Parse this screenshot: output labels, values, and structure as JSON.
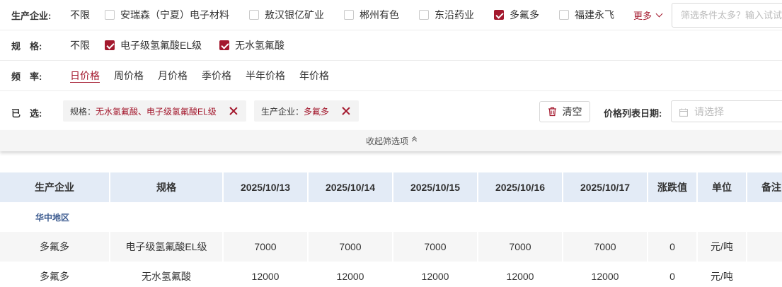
{
  "filters": {
    "producer": {
      "label": "生产企业:",
      "unlimited": "不限",
      "options": [
        {
          "label": "安瑞森（宁夏）电子材料",
          "checked": false
        },
        {
          "label": "敖汉银亿矿业",
          "checked": false
        },
        {
          "label": "郴州有色",
          "checked": false
        },
        {
          "label": "东沿药业",
          "checked": false
        },
        {
          "label": "多氟多",
          "checked": true
        },
        {
          "label": "福建永飞",
          "checked": false
        }
      ],
      "more_label": "更多",
      "search_placeholder": "筛选条件太多？输入试试"
    },
    "spec": {
      "label": "规　格:",
      "unlimited": "不限",
      "options": [
        {
          "label": "电子级氢氟酸EL级",
          "checked": true
        },
        {
          "label": "无水氢氟酸",
          "checked": true
        }
      ]
    },
    "frequency": {
      "label": "频　率:",
      "options": [
        {
          "label": "日价格",
          "active": true
        },
        {
          "label": "周价格",
          "active": false
        },
        {
          "label": "月价格",
          "active": false
        },
        {
          "label": "季价格",
          "active": false
        },
        {
          "label": "半年价格",
          "active": false
        },
        {
          "label": "年价格",
          "active": false
        }
      ]
    },
    "selected": {
      "label": "已　选:",
      "tags": [
        {
          "key": "规格：",
          "value": "无水氢氟酸、电子级氢氟酸EL级"
        },
        {
          "key": "生产企业：",
          "value": "多氟多"
        }
      ],
      "clear_label": "清空",
      "date_label": "价格列表日期:",
      "date_placeholder": "请选择"
    },
    "collapse_label": "收起筛选项"
  },
  "table": {
    "headers": [
      "生产企业",
      "规格",
      "2025/10/13",
      "2025/10/14",
      "2025/10/15",
      "2025/10/16",
      "2025/10/17",
      "涨跌值",
      "单位",
      "备注"
    ],
    "region": "华中地区",
    "rows": [
      [
        "多氟多",
        "电子级氢氟酸EL级",
        "7000",
        "7000",
        "7000",
        "7000",
        "7000",
        "0",
        "元/吨",
        ""
      ],
      [
        "多氟多",
        "无水氢氟酸",
        "12000",
        "12000",
        "12000",
        "12000",
        "12000",
        "0",
        "元/吨",
        ""
      ]
    ]
  },
  "colors": {
    "accent": "#a3182d",
    "header_bg": "#e3ebf6",
    "region_text": "#3b5a8f"
  }
}
